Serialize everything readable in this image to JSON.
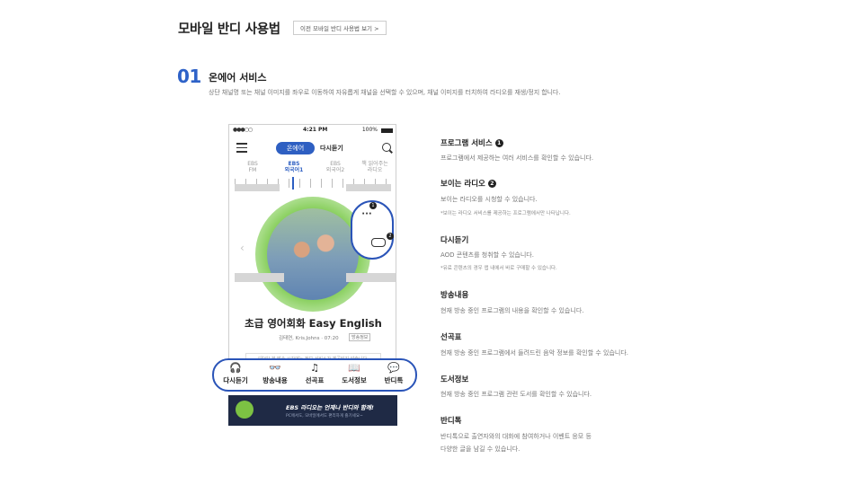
{
  "page": {
    "title": "모바일 반디 사용법",
    "prev_link": "이전 모바일 반디 사용법 보기 >",
    "section_number": "01",
    "section_title": "온에어 서비스",
    "section_desc": "상단 채널명 또는 채널 이미지를 좌우로 이동하여 자유롭게 채널을 선택할 수 있으며, 채널 이미지를 터치하여 라디오를 재생/정지 합니다."
  },
  "phone": {
    "status_time": "4:21 PM",
    "status_carrier": "●●●○○",
    "status_battery": "100%",
    "tab_onair": "온에어",
    "tab_replay": "다시듣기",
    "channels": [
      {
        "l1": "EBS",
        "l2": "FM"
      },
      {
        "l1": "EBS",
        "l2": "외국어1"
      },
      {
        "l1": "EBS",
        "l2": "외국어2"
      },
      {
        "l1": "책 읽어주는",
        "l2": "라디오"
      }
    ],
    "more_dots": "···",
    "badge1": "1",
    "badge2": "2",
    "program_title": "초급 영어회화 Easy English",
    "program_host": "김태연, Kris.Johns · 07:20",
    "program_chip": "방송정보",
    "notice": "[알림] 본 방송 시간에는 정보 서비스가 제공되지 않습니다.",
    "nav": [
      {
        "icon": "headphones-icon",
        "glyph": "🎧",
        "label": "다시듣기"
      },
      {
        "icon": "glasses-icon",
        "glyph": "👓",
        "label": "방송내용"
      },
      {
        "icon": "music-note-icon",
        "glyph": "♫",
        "label": "선곡표"
      },
      {
        "icon": "book-icon",
        "glyph": "📖",
        "label": "도서정보"
      },
      {
        "icon": "chat-icon",
        "glyph": "💬",
        "label": "반디톡"
      }
    ],
    "banner_text": "EBS 라디오는 언제나 반디와 함께!",
    "banner_sub": "PC에서도, 모바일에서도 편리하게 즐기세요~"
  },
  "features": [
    {
      "title": "프로그램 서비스",
      "badge": "1",
      "desc": "프로그램에서 제공하는 여러 서비스를 확인할 수 있습니다.",
      "note": ""
    },
    {
      "title": "보이는 라디오",
      "badge": "2",
      "desc": "보이는 라디오를 시청할 수 있습니다.",
      "note": "*보이는 라디오 서비스를 제공하는 프로그램에서만 나타납니다."
    },
    {
      "title": "다시듣기",
      "badge": "",
      "desc": "AOD 콘텐츠를 청취할 수 있습니다.",
      "note": "*유료 콘텐츠의 경우 앱 내에서 바로 구매할 수 있습니다."
    },
    {
      "title": "방송내용",
      "badge": "",
      "desc": "현재 방송 중인 프로그램의 내용을 확인할 수 있습니다.",
      "note": ""
    },
    {
      "title": "선곡표",
      "badge": "",
      "desc": "현재 방송 중인 프로그램에서 들려드린 음악 정보를 확인할 수 있습니다.",
      "note": ""
    },
    {
      "title": "도서정보",
      "badge": "",
      "desc": "현재 방송 중인 프로그램 관련 도서를 확인할 수 있습니다.",
      "note": ""
    },
    {
      "title": "반디톡",
      "badge": "",
      "desc": "반디톡으로 출연자와의 대화에 참여하거나 이벤트 응모 등",
      "note": "다양한 글을 남길 수 있습니다."
    }
  ],
  "colors": {
    "accent": "#2e5fc2",
    "highlight_border": "#2a54b8",
    "onair_green": "#7bc94b"
  }
}
